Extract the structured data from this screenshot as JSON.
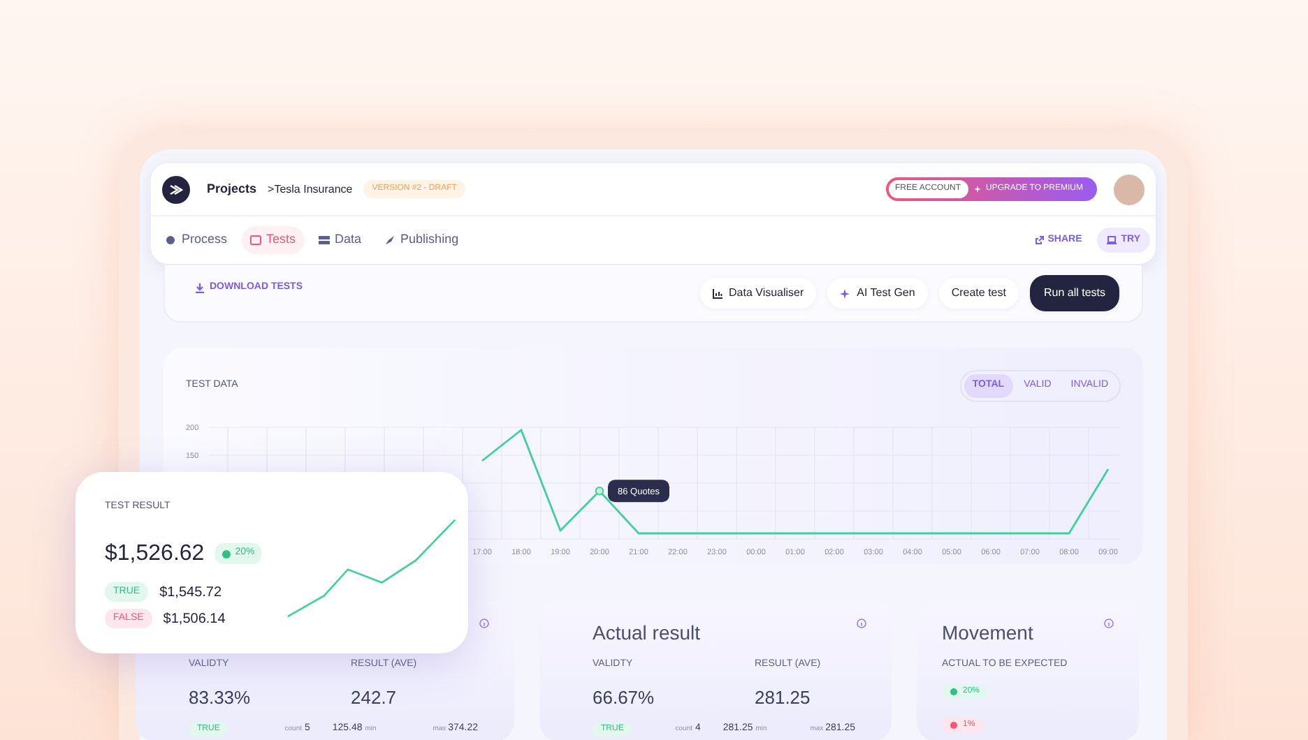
{
  "header": {
    "breadcrumb": [
      "Projects",
      ">Tesla Insurance"
    ],
    "version_badge": "VERSION #2 - DRAFT",
    "account_badge": "FREE ACCOUNT",
    "upgrade_button": "UPGRADE TO PREMIUM"
  },
  "nav": {
    "tabs": [
      {
        "label": "Process",
        "selected": false
      },
      {
        "label": "Tests",
        "selected": true
      },
      {
        "label": "Data",
        "selected": false
      },
      {
        "label": "Publishing",
        "selected": false
      }
    ],
    "actions": [
      {
        "label": "SHARE",
        "kind": "share"
      },
      {
        "label": "TRY",
        "kind": "try"
      }
    ]
  },
  "toolbar": {
    "download": "DOWNLOAD TESTS",
    "buttons": [
      {
        "label": "Data Visualiser",
        "kind": "chart"
      },
      {
        "label": "AI Test Gen",
        "kind": "sparkle"
      },
      {
        "label": "Create test",
        "kind": "plain"
      },
      {
        "label": "Run all tests",
        "kind": "primary"
      }
    ]
  },
  "test_data": {
    "title": "TEST DATA",
    "filters": [
      {
        "label": "TOTAL",
        "selected": true
      },
      {
        "label": "VALID",
        "selected": false
      },
      {
        "label": "INVALID",
        "selected": false
      }
    ],
    "chart_data": {
      "type": "line",
      "categories": [
        "17:00",
        "18:00",
        "19:00",
        "20:00",
        "21:00",
        "22:00",
        "23:00",
        "00:00",
        "01:00",
        "02:00",
        "03:00",
        "04:00",
        "05:00",
        "06:00",
        "07:00",
        "08:00",
        "09:00"
      ],
      "ylim": [
        0,
        200
      ],
      "yticks": [
        150,
        200
      ],
      "annotations": [
        {
          "x": "20:00",
          "text": "86 Quotes"
        }
      ],
      "series": [
        {
          "color": "#3fd19b",
          "values": [
            140,
            195,
            15,
            86,
            10,
            10,
            10,
            10,
            10,
            10,
            10,
            10,
            10,
            10,
            10,
            10,
            125
          ]
        }
      ]
    }
  },
  "test_result": {
    "title": "TEST RESULT",
    "value": "$1,526.62",
    "change": "20%",
    "rows": [
      {
        "label": "TRUE",
        "value": "$1,545.72",
        "kind": "true"
      },
      {
        "label": "FALSE",
        "value": "$1,506.14",
        "kind": "false"
      }
    ]
  },
  "summary_cards": [
    {
      "validity_label": "VALIDTY",
      "validity": "83.33%",
      "result_label": "RESULT (AVE)",
      "result": "242.7",
      "badge": "TRUE",
      "count_label": "count",
      "count": "5",
      "min": "125.48",
      "min_label": "min",
      "max_label": "max",
      "max": "374.22"
    },
    {
      "title": "Actual result",
      "validity_label": "VALIDTY",
      "validity": "66.67%",
      "result_label": "RESULT (AVE)",
      "result": "281.25",
      "badge": "TRUE",
      "count_label": "count",
      "count": "4",
      "min": "281.25",
      "min_label": "min",
      "max_label": "max",
      "max": "281.25"
    }
  ],
  "movement": {
    "title": "Movement",
    "label": "ACTUAL TO BE EXPECTED",
    "changes": [
      {
        "text": "20%",
        "kind": "up"
      },
      {
        "text": "1%",
        "kind": "down"
      }
    ]
  }
}
